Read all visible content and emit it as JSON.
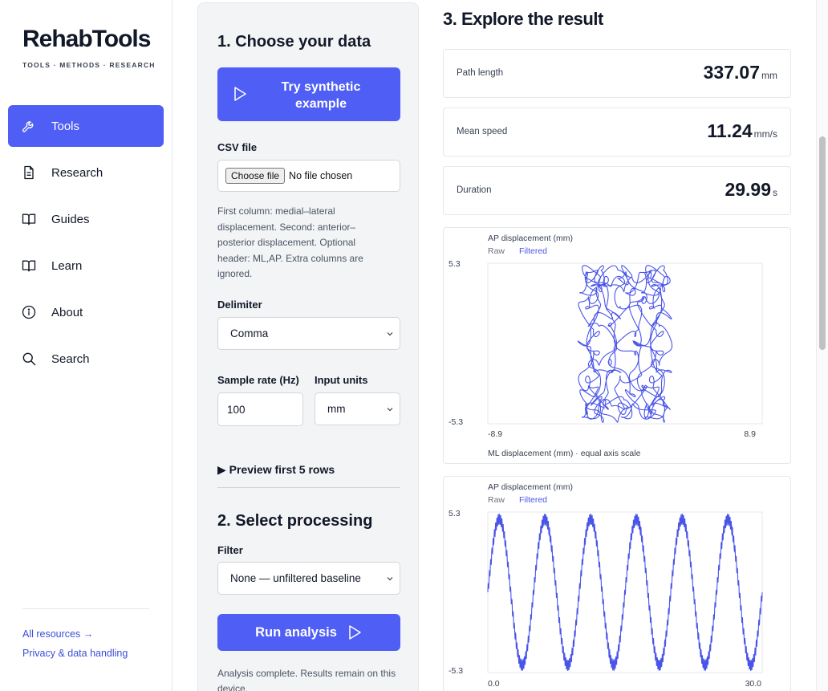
{
  "sidebar": {
    "brand": "RehabTools",
    "tagline": "TOOLS · METHODS · RESEARCH",
    "items": [
      {
        "label": "Tools",
        "icon": "wrench-icon"
      },
      {
        "label": "Research",
        "icon": "document-icon"
      },
      {
        "label": "Guides",
        "icon": "book-icon"
      },
      {
        "label": "Learn",
        "icon": "book-icon"
      },
      {
        "label": "About",
        "icon": "info-icon"
      },
      {
        "label": "Search",
        "icon": "search-icon"
      }
    ],
    "footer_links": [
      "All resources →",
      "Privacy & data handling"
    ]
  },
  "step1": {
    "heading": "1. Choose your data",
    "try_button": "Try synthetic example",
    "csv_label": "CSV file",
    "file_button": "Choose file",
    "file_status": "No file chosen",
    "help": "First column: medial–lateral displacement. Second: anterior–posterior displacement. Optional header: ML,AP. Extra columns are ignored.",
    "delimiter_label": "Delimiter",
    "delimiter_value": "Comma",
    "sample_rate_label": "Sample rate (Hz)",
    "sample_rate_value": "100",
    "units_label": "Input units",
    "units_value": "mm",
    "preview": "▶ Preview first 5 rows"
  },
  "step2": {
    "heading": "2. Select processing",
    "filter_label": "Filter",
    "filter_value": "None — unfiltered baseline",
    "run_button": "Run analysis",
    "status": "Analysis complete. Results remain on this device."
  },
  "step3": {
    "heading": "3. Explore the result",
    "metrics": [
      {
        "label": "Path length",
        "value": "337.07",
        "unit": "mm"
      },
      {
        "label": "Mean speed",
        "value": "11.24",
        "unit": "mm/s"
      },
      {
        "label": "Duration",
        "value": "29.99",
        "unit": "s"
      }
    ]
  },
  "colors": {
    "accent": "#4f5ef5",
    "series": "#4a55e8"
  },
  "chart_data": [
    {
      "type": "line",
      "ylabel": "AP displacement (mm)",
      "xlabel": "ML displacement (mm) · equal axis scale",
      "legend": [
        "Raw",
        "Filtered"
      ],
      "xlim": [
        -8.9,
        8.9
      ],
      "ylim": [
        -5.3,
        5.3
      ],
      "x_ticks": [
        "-8.9",
        "8.9"
      ],
      "y_ticks": [
        "5.3",
        "-5.3"
      ],
      "series": [
        {
          "name": "Raw",
          "description_values": {
            "ml_range": [
              -2.9,
              2.9
            ],
            "ap_range": [
              -5.2,
              5.2
            ]
          }
        }
      ]
    },
    {
      "type": "line",
      "ylabel": "AP displacement (mm)",
      "legend": [
        "Raw",
        "Filtered"
      ],
      "xlim": [
        0.0,
        30.0
      ],
      "ylim": [
        -5.3,
        5.3
      ],
      "x_ticks": [
        "0.0",
        "30.0"
      ],
      "y_ticks": [
        "5.3",
        "-5.3"
      ],
      "series": [
        {
          "name": "Raw",
          "amplitude": 5.2,
          "period_s": 5.0,
          "duration_s": 30.0
        }
      ]
    }
  ]
}
